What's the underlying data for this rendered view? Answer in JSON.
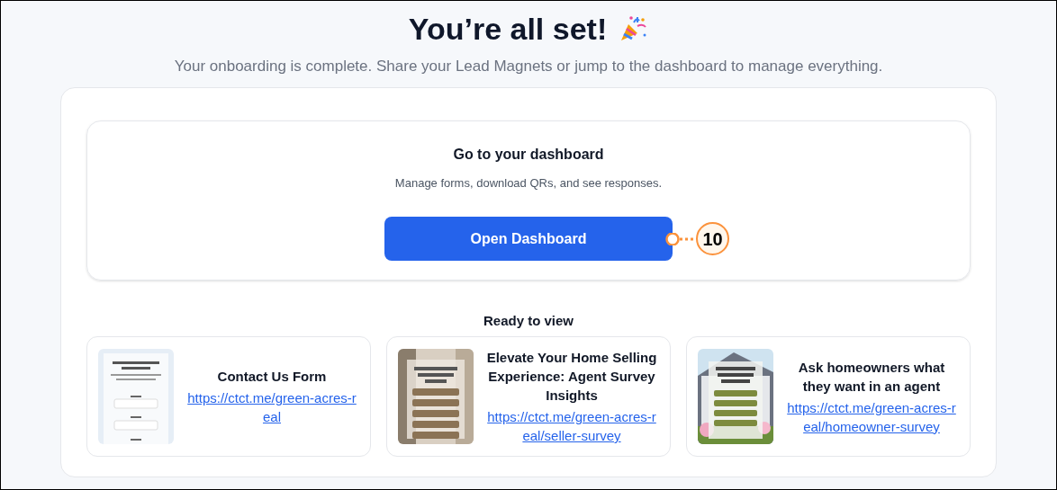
{
  "header": {
    "title": "You’re all set!",
    "subtitle": "Your onboarding is complete. Share your Lead Magnets or jump to the dashboard to manage everything."
  },
  "dashboard": {
    "title": "Go to your dashboard",
    "description": "Manage forms, download QRs, and see responses.",
    "button": "Open Dashboard",
    "callout": "10"
  },
  "ready": {
    "title": "Ready to view",
    "items": [
      {
        "kind": "form",
        "title": "Contact Us Form",
        "link": "https://ctct.me/green-acres-real"
      },
      {
        "kind": "interior",
        "title": "Elevate Your Home Selling Experience: Agent Survey Insights",
        "link": "https://ctct.me/green-acres-real/seller-survey"
      },
      {
        "kind": "house",
        "title": "Ask homeowners what they want in an agent",
        "link": "https://ctct.me/green-acres-real/homeowner-survey"
      }
    ]
  }
}
